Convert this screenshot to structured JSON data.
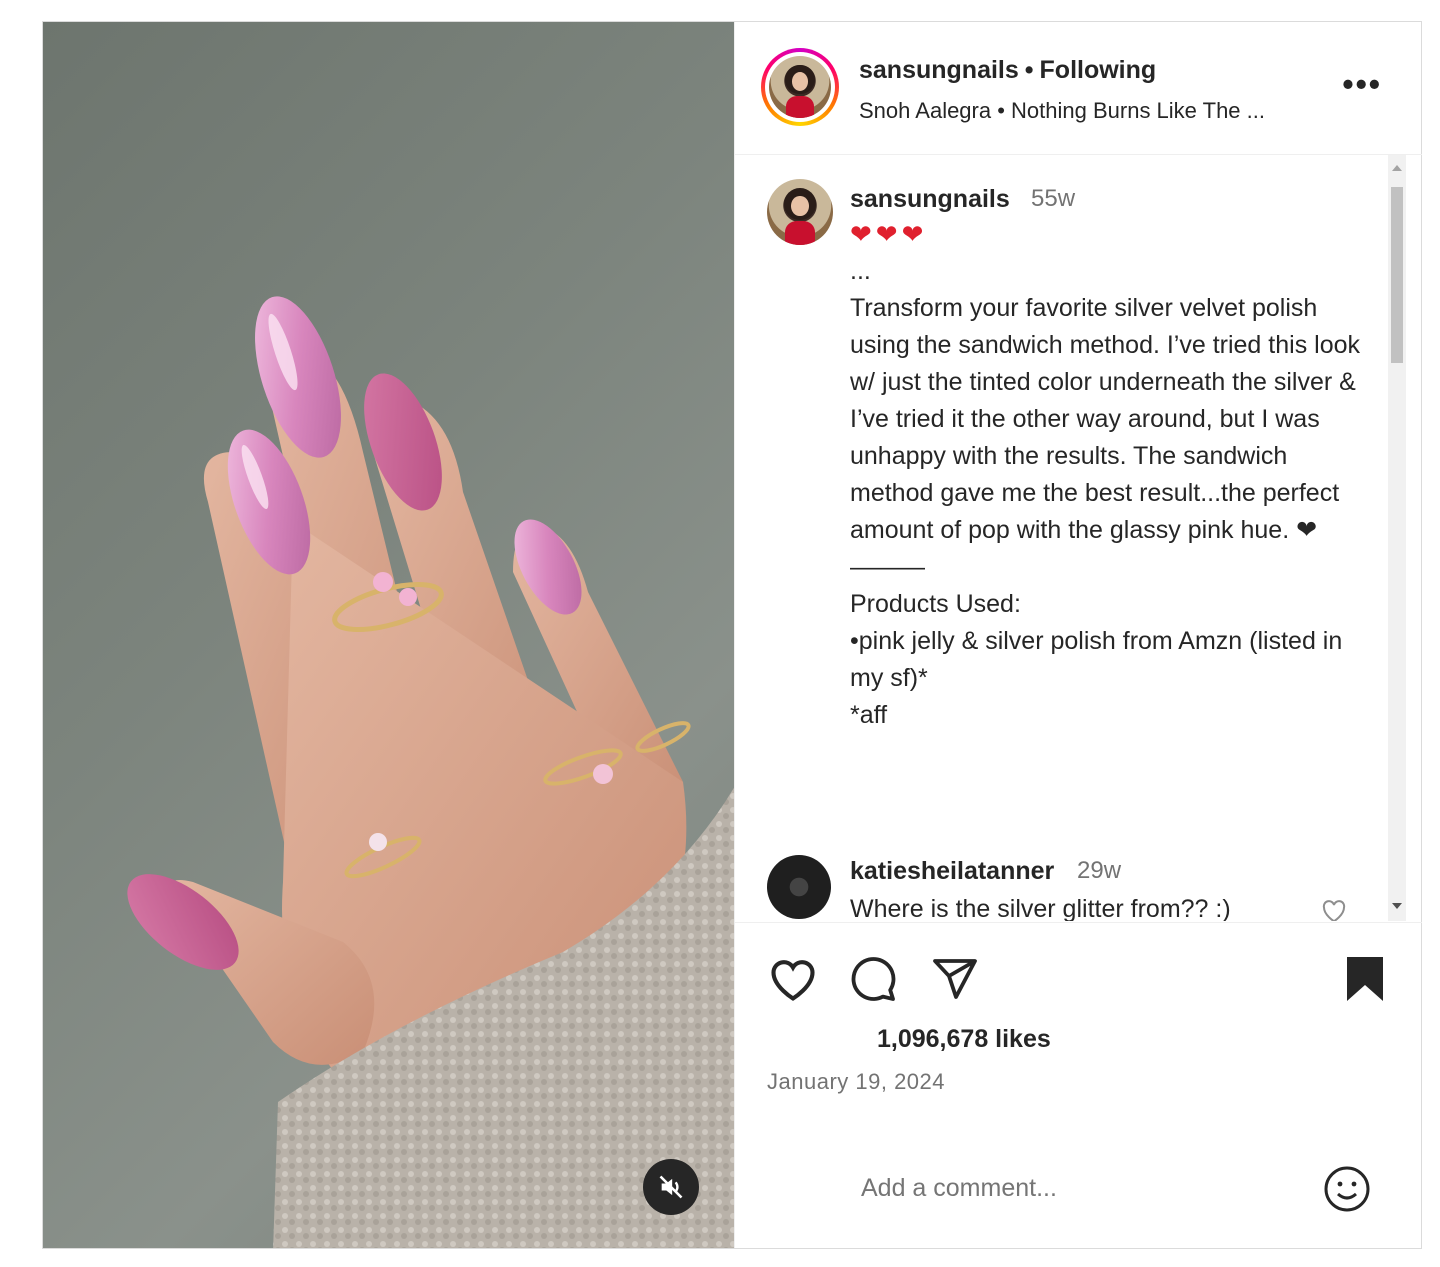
{
  "header": {
    "username": "sansungnails",
    "follow_status": "Following",
    "audio": "Snoh Aalegra • Nothing Burns Like The ...",
    "more_label": "•••"
  },
  "caption": {
    "username": "sansungnails",
    "time": "55w",
    "hearts": "❤❤❤",
    "body": "...\nTransform your favorite silver velvet polish using the sandwich method. I’ve tried this look w/ just the tinted color underneath the silver & I’ve tried it the other way around, but I was unhappy with the results. The sandwich method gave me the best result...the perfect amount of pop with the glassy pink hue. ❤\n———\nProducts Used:\n•pink jelly & silver polish from Amzn (listed in my sf)*\n*aff"
  },
  "comment": {
    "username": "katiesheilatanner",
    "time": "29w",
    "text": "Where is the silver glitter from?? :)"
  },
  "actions": {
    "likes": "1,096,678 likes",
    "date": "January 19, 2024",
    "comment_placeholder": "Add a comment..."
  },
  "icons": [
    "heart-icon",
    "comment-icon",
    "share-icon",
    "bookmark-icon",
    "emoji-icon",
    "mute-icon",
    "more-icon"
  ],
  "colors": {
    "heart": "#e0202e",
    "text": "#262626",
    "muted": "#737373",
    "nail_pink": "#d98ab8"
  }
}
